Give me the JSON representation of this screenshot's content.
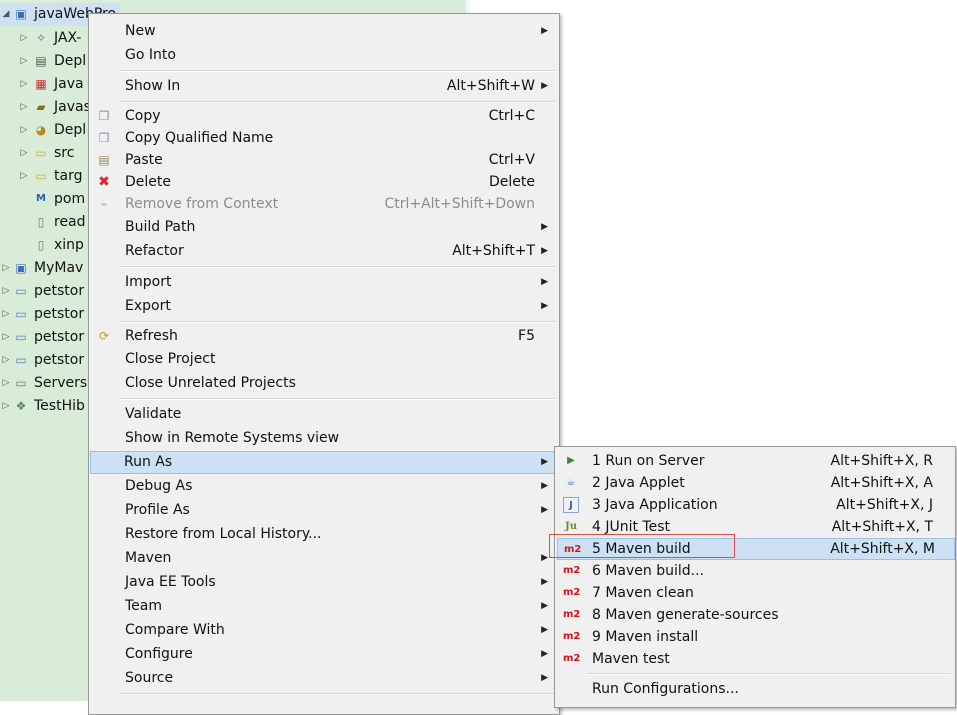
{
  "explorer": {
    "items": [
      {
        "label": "javaWebPro",
        "arrow": "◢",
        "icon": "maven-web-project-icon"
      },
      {
        "label": "JAX-",
        "arrow": "▷",
        "icon": "jax-ws-icon"
      },
      {
        "label": "Depl",
        "arrow": "▷",
        "icon": "deployment-descriptor-icon"
      },
      {
        "label": "Java",
        "arrow": "▷",
        "icon": "java-resources-icon"
      },
      {
        "label": "Javas",
        "arrow": "▷",
        "icon": "javascript-resources-icon"
      },
      {
        "label": "Depl",
        "arrow": "▷",
        "icon": "deployed-resources-icon"
      },
      {
        "label": "src",
        "arrow": "▷",
        "icon": "folder-icon"
      },
      {
        "label": "targ",
        "arrow": "▷",
        "icon": "folder-icon"
      },
      {
        "label": "pom",
        "arrow": "",
        "icon": "pom-file-icon"
      },
      {
        "label": "read",
        "arrow": "",
        "icon": "file-icon"
      },
      {
        "label": "xinp",
        "arrow": "",
        "icon": "file-icon"
      },
      {
        "label": "MyMav",
        "arrow": "▷",
        "icon": "maven-project-icon"
      },
      {
        "label": "petstor",
        "arrow": "▷",
        "icon": "project-folder-icon"
      },
      {
        "label": "petstor",
        "arrow": "▷",
        "icon": "project-folder-icon"
      },
      {
        "label": "petstor",
        "arrow": "▷",
        "icon": "project-folder-icon"
      },
      {
        "label": "petstor",
        "arrow": "▷",
        "icon": "project-folder-icon"
      },
      {
        "label": "Servers",
        "arrow": "▷",
        "icon": "servers-folder-icon"
      },
      {
        "label": "TestHib",
        "arrow": "▷",
        "icon": "hibernate-project-icon"
      }
    ]
  },
  "context_menu": {
    "items": [
      {
        "label": "New",
        "accel": "",
        "submenu": true,
        "icon": ""
      },
      {
        "label": "Go Into",
        "accel": "",
        "submenu": false,
        "icon": ""
      },
      {
        "label": "Show In",
        "accel": "Alt+Shift+W",
        "submenu": true,
        "icon": ""
      },
      {
        "label": "Copy",
        "accel": "Ctrl+C",
        "submenu": false,
        "icon": "copy-icon"
      },
      {
        "label": "Copy Qualified Name",
        "accel": "",
        "submenu": false,
        "icon": "copy-qualified-icon"
      },
      {
        "label": "Paste",
        "accel": "Ctrl+V",
        "submenu": false,
        "icon": "paste-icon"
      },
      {
        "label": "Delete",
        "accel": "Delete",
        "submenu": false,
        "icon": "delete-icon"
      },
      {
        "label": "Remove from Context",
        "accel": "Ctrl+Alt+Shift+Down",
        "submenu": false,
        "icon": "remove-context-icon",
        "disabled": true
      },
      {
        "label": "Build Path",
        "accel": "",
        "submenu": true,
        "icon": ""
      },
      {
        "label": "Refactor",
        "accel": "Alt+Shift+T",
        "submenu": true,
        "icon": ""
      },
      {
        "label": "Import",
        "accel": "",
        "submenu": true,
        "icon": ""
      },
      {
        "label": "Export",
        "accel": "",
        "submenu": true,
        "icon": ""
      },
      {
        "label": "Refresh",
        "accel": "F5",
        "submenu": false,
        "icon": "refresh-icon"
      },
      {
        "label": "Close Project",
        "accel": "",
        "submenu": false,
        "icon": ""
      },
      {
        "label": "Close Unrelated Projects",
        "accel": "",
        "submenu": false,
        "icon": ""
      },
      {
        "label": "Validate",
        "accel": "",
        "submenu": false,
        "icon": ""
      },
      {
        "label": "Show in Remote Systems view",
        "accel": "",
        "submenu": false,
        "icon": ""
      },
      {
        "label": "Run As",
        "accel": "",
        "submenu": true,
        "icon": "",
        "highlighted": true
      },
      {
        "label": "Debug As",
        "accel": "",
        "submenu": true,
        "icon": ""
      },
      {
        "label": "Profile As",
        "accel": "",
        "submenu": true,
        "icon": ""
      },
      {
        "label": "Restore from Local History...",
        "accel": "",
        "submenu": false,
        "icon": ""
      },
      {
        "label": "Maven",
        "accel": "",
        "submenu": true,
        "icon": ""
      },
      {
        "label": "Java EE Tools",
        "accel": "",
        "submenu": true,
        "icon": ""
      },
      {
        "label": "Team",
        "accel": "",
        "submenu": true,
        "icon": ""
      },
      {
        "label": "Compare With",
        "accel": "",
        "submenu": true,
        "icon": ""
      },
      {
        "label": "Configure",
        "accel": "",
        "submenu": true,
        "icon": ""
      },
      {
        "label": "Source",
        "accel": "",
        "submenu": true,
        "icon": ""
      }
    ]
  },
  "run_as_submenu": {
    "items": [
      {
        "label": "1 Run on Server",
        "accel": "Alt+Shift+X, R",
        "icon": "run-on-server-icon",
        "glyph": "▶"
      },
      {
        "label": "2 Java Applet",
        "accel": "Alt+Shift+X, A",
        "icon": "java-applet-icon",
        "glyph": "☕"
      },
      {
        "label": "3 Java Application",
        "accel": "Alt+Shift+X, J",
        "icon": "java-application-icon",
        "glyph": "J"
      },
      {
        "label": "4 JUnit Test",
        "accel": "Alt+Shift+X, T",
        "icon": "junit-icon",
        "glyph": "Ju"
      },
      {
        "label": "5 Maven build",
        "accel": "Alt+Shift+X, M",
        "icon": "maven-m2-icon",
        "glyph": "m2",
        "highlighted": true
      },
      {
        "label": "6 Maven build...",
        "accel": "",
        "icon": "maven-m2-icon",
        "glyph": "m2"
      },
      {
        "label": "7 Maven clean",
        "accel": "",
        "icon": "maven-m2-icon",
        "glyph": "m2"
      },
      {
        "label": "8 Maven generate-sources",
        "accel": "",
        "icon": "maven-m2-icon",
        "glyph": "m2"
      },
      {
        "label": "9 Maven install",
        "accel": "",
        "icon": "maven-m2-icon",
        "glyph": "m2"
      },
      {
        "label": "Maven test",
        "accel": "",
        "icon": "maven-m2-icon",
        "glyph": "m2"
      },
      {
        "label": "Run Configurations...",
        "accel": "",
        "icon": "",
        "glyph": ""
      }
    ]
  },
  "colors": {
    "explorer_bg": "#d9ecd7",
    "menu_bg": "#f0f0f0",
    "highlight": "#cde0f4",
    "annotation_box": "#e34b4b",
    "maven_red": "#d4141a"
  }
}
